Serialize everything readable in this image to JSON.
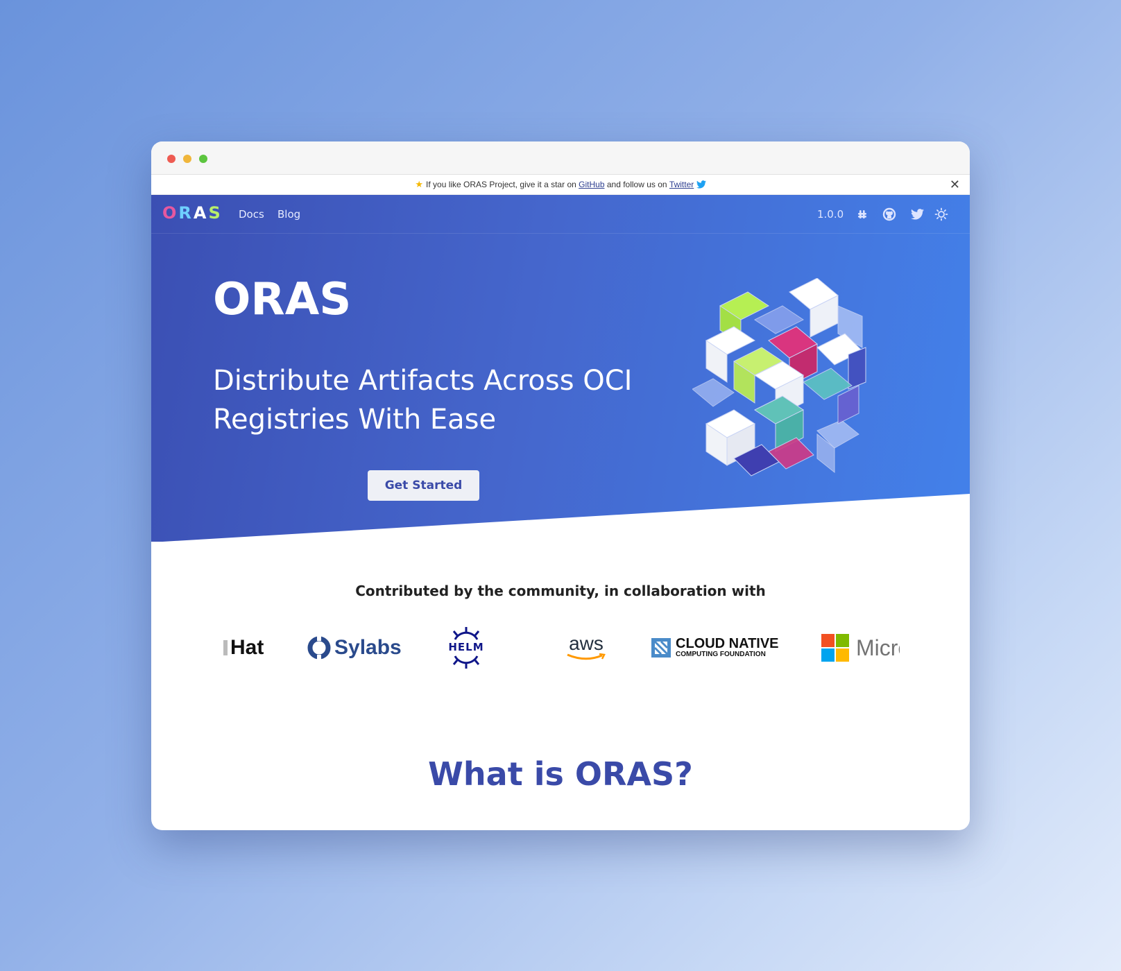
{
  "announcement": {
    "prefix": "If you like ORAS Project, give it a star on",
    "github_link": "GitHub",
    "middle": "and follow us on",
    "twitter_link": "Twitter"
  },
  "nav": {
    "logo": "ORAS",
    "links": [
      "Docs",
      "Blog"
    ],
    "version": "1.0.0",
    "icons": [
      "slack-icon",
      "github-icon",
      "twitter-icon",
      "theme-toggle-icon"
    ]
  },
  "hero": {
    "title": "ORAS",
    "subtitle": "Distribute Artifacts Across OCI Registries With Ease",
    "cta": "Get Started"
  },
  "collaboration": {
    "heading": "Contributed by the community, in collaboration with",
    "logos": {
      "redhat": "Hat",
      "sylabs": "Sylabs",
      "helm": "HELM",
      "aws": "aws",
      "cncf_line1": "CLOUD NATIVE",
      "cncf_line2": "COMPUTING FOUNDATION",
      "microsoft": "Micro"
    }
  },
  "section": {
    "what_is": "What is ORAS?"
  },
  "colors": {
    "accent": "#3a4aa8",
    "hero_start": "#3b4fb3",
    "hero_end": "#4381ea"
  }
}
